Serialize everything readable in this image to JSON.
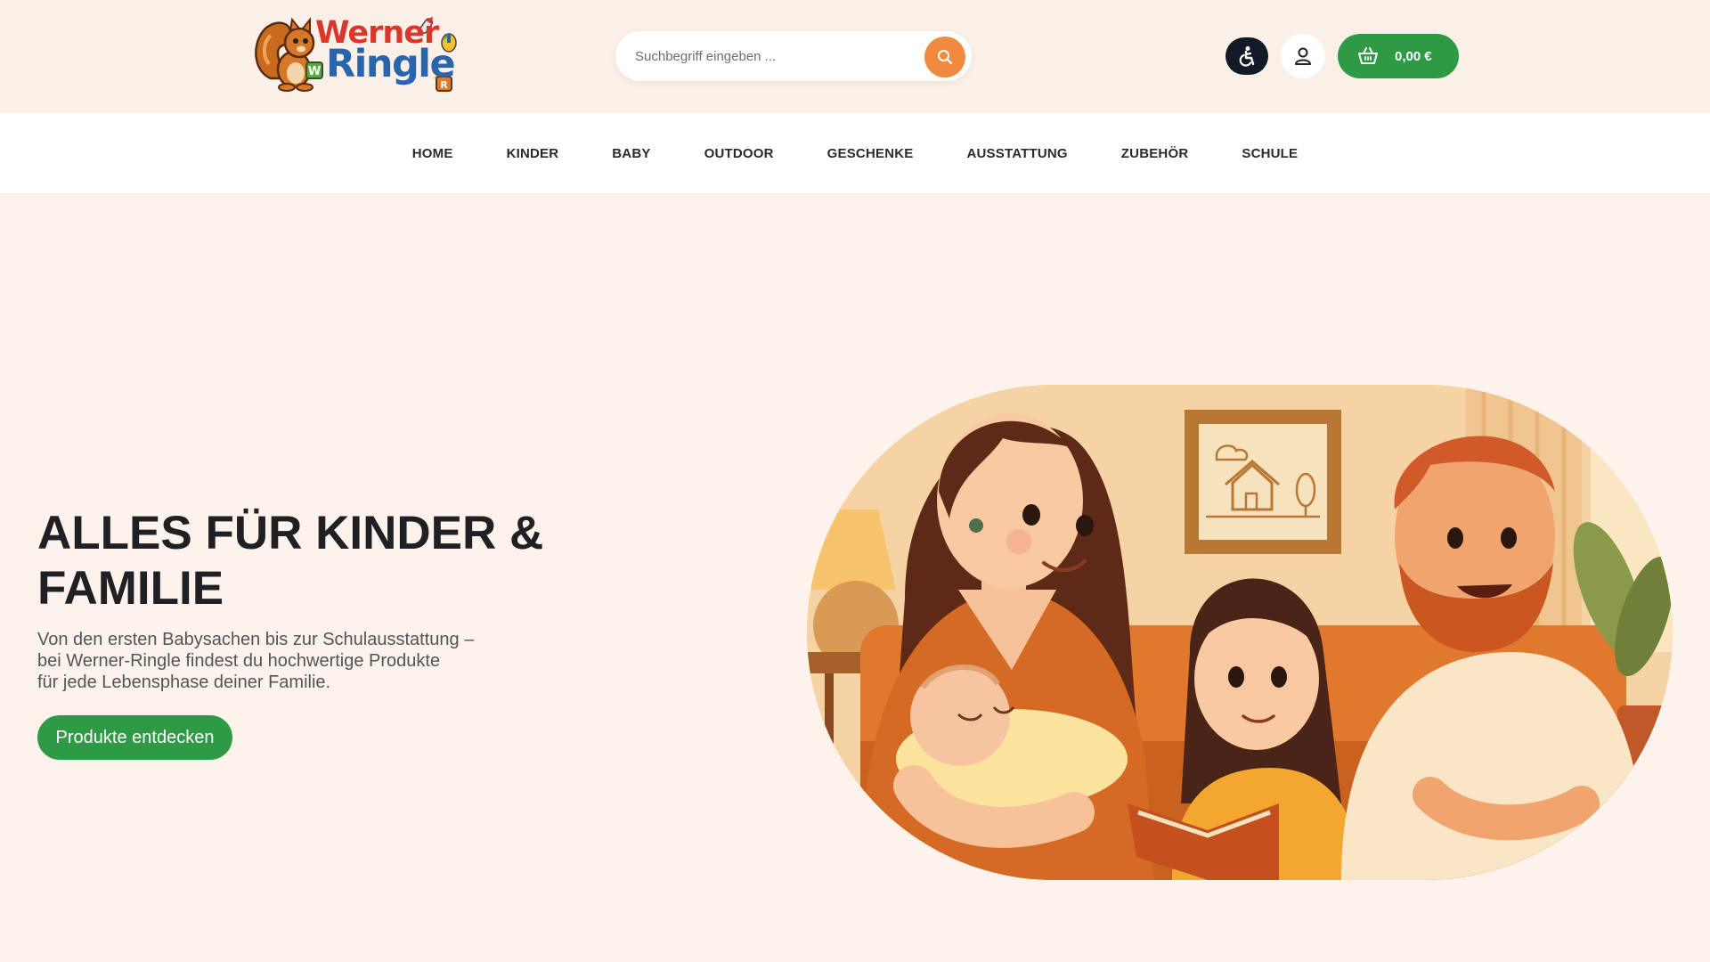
{
  "brand": {
    "logo_line1": "Werner",
    "logo_line2": "Ringle",
    "colors": {
      "red": "#d7382e",
      "blue": "#2a64ad",
      "green": "#2e9a45",
      "orange": "#f08a3e"
    }
  },
  "header": {
    "search": {
      "placeholder": "Suchbegriff eingeben ...",
      "icon": "search-icon"
    },
    "accessibility_icon": "accessibility-icon",
    "account_icon": "user-icon",
    "cart": {
      "icon": "basket-icon",
      "amount": "0,00 €"
    }
  },
  "nav": {
    "items": [
      {
        "label": "HOME"
      },
      {
        "label": "KINDER"
      },
      {
        "label": "BABY"
      },
      {
        "label": "OUTDOOR"
      },
      {
        "label": "GESCHENKE"
      },
      {
        "label": "AUSSTATTUNG"
      },
      {
        "label": "ZUBEHÖR"
      },
      {
        "label": "SCHULE"
      }
    ]
  },
  "hero": {
    "title_line1": "ALLES FÜR KINDER &",
    "title_line2": "FAMILIE",
    "subtitle_line1": "Von den ersten Babysachen bis zur Schulausstattung –",
    "subtitle_line2": "bei Werner-Ringle findest du hochwertige Produkte",
    "subtitle_line3": "für jede Lebensphase deiner Familie.",
    "cta_label": "Produkte entdecken"
  }
}
